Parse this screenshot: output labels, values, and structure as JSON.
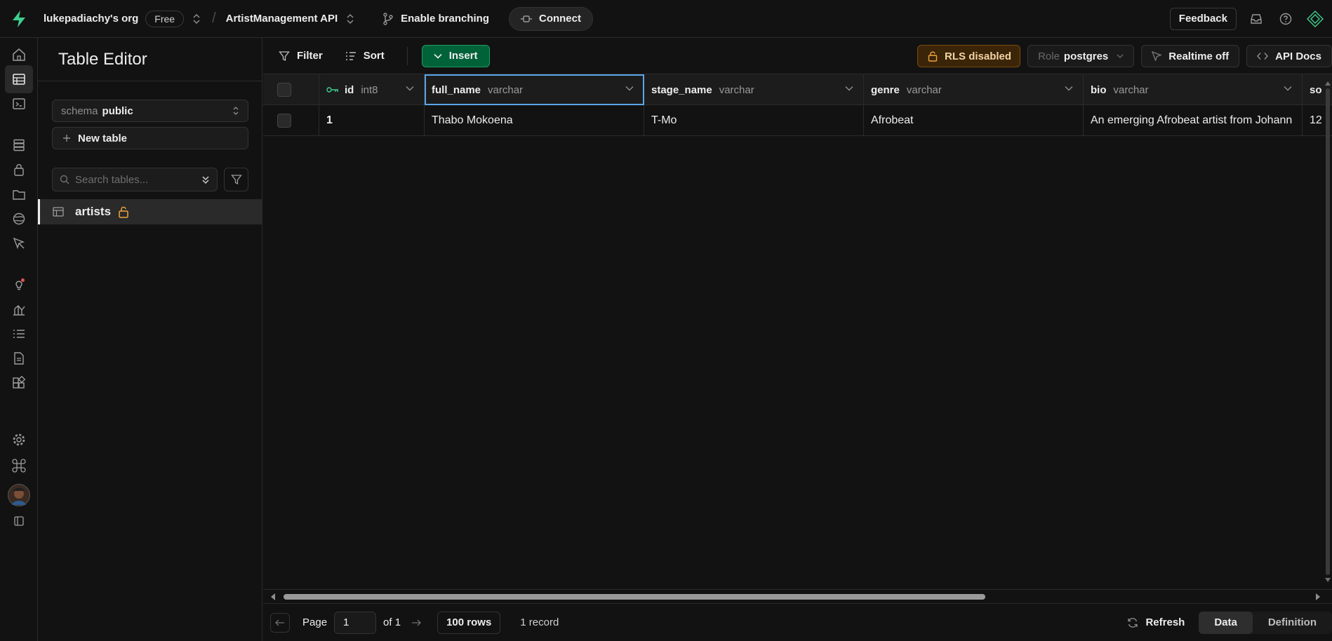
{
  "topbar": {
    "org": "lukepadiachy's org",
    "plan": "Free",
    "project": "ArtistManagement API",
    "branching": "Enable branching",
    "connect": "Connect",
    "feedback": "Feedback"
  },
  "sidebar": {
    "title": "Table Editor",
    "schema_label": "schema",
    "schema_value": "public",
    "new_table": "New table",
    "search_placeholder": "Search tables...",
    "tables": [
      {
        "name": "artists"
      }
    ]
  },
  "toolbar": {
    "filter": "Filter",
    "sort": "Sort",
    "insert": "Insert",
    "rls": "RLS disabled",
    "role_label": "Role",
    "role_value": "postgres",
    "realtime": "Realtime off",
    "api_docs": "API Docs"
  },
  "grid": {
    "columns": [
      {
        "name": "id",
        "type": "int8"
      },
      {
        "name": "full_name",
        "type": "varchar"
      },
      {
        "name": "stage_name",
        "type": "varchar"
      },
      {
        "name": "genre",
        "type": "varchar"
      },
      {
        "name": "bio",
        "type": "varchar"
      },
      {
        "name": "so",
        "type": ""
      }
    ],
    "rows": [
      [
        "1",
        "Thabo Mokoena",
        "T-Mo",
        "Afrobeat",
        "An emerging Afrobeat artist from Johann",
        "12"
      ]
    ]
  },
  "footer": {
    "page_label": "Page",
    "page_value": "1",
    "of_label": "of 1",
    "rows_per_page": "100 rows",
    "record_count": "1 record",
    "refresh": "Refresh",
    "tab_data": "Data",
    "tab_definition": "Definition"
  },
  "colors": {
    "accent": "#3ecf8e",
    "insert_bg": "#006239",
    "rls_warning": "#f0a53b",
    "selection": "#5aa6e8"
  }
}
